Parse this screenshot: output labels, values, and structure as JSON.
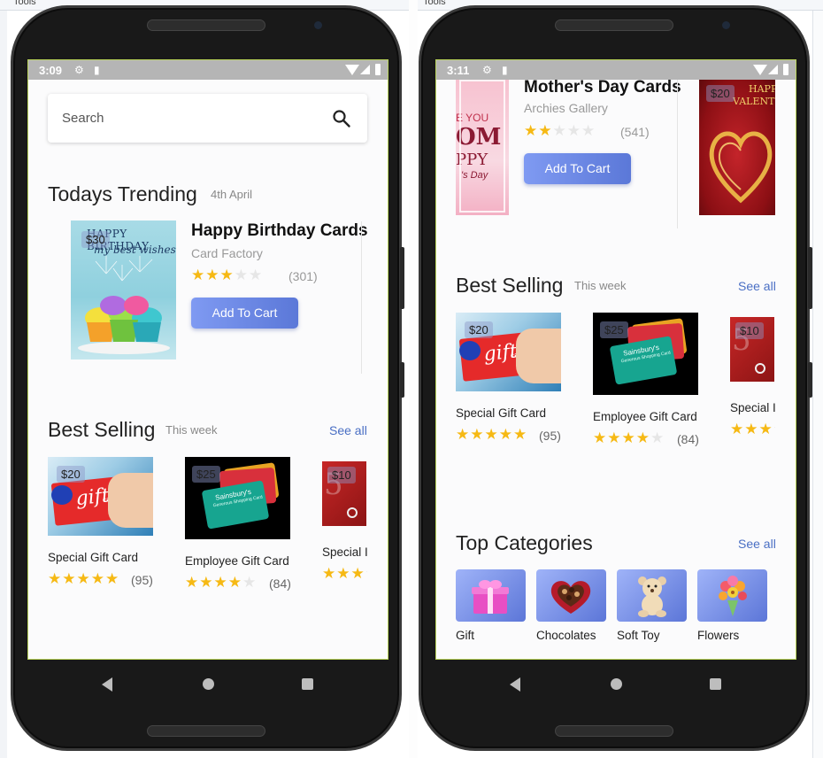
{
  "ide": {
    "menu_left": "Tools",
    "menu_right": "Tools"
  },
  "left": {
    "status": {
      "time": "3:09"
    },
    "search": {
      "placeholder": "Search"
    },
    "trending": {
      "title": "Todays Trending",
      "date": "4th April",
      "card": {
        "title": "Happy Birthday Cards",
        "vendor": "Card Factory",
        "rating": 3,
        "reviews": "(301)",
        "price": "$30",
        "button": "Add To Cart",
        "image_text": [
          "HAPPY BIRTHDAY",
          "my best wishes"
        ]
      }
    },
    "best_selling": {
      "title": "Best Selling",
      "subtitle": "This week",
      "see_all": "See all",
      "items": [
        {
          "name": "Special Gift Card",
          "price": "$20",
          "rating": 5,
          "reviews": "(95)"
        },
        {
          "name": "Employee Gift Card",
          "price": "$25",
          "rating": 4,
          "reviews": "(84)"
        },
        {
          "name": "Special I",
          "price": "$10",
          "rating": 3,
          "reviews": ""
        }
      ]
    }
  },
  "right": {
    "status": {
      "time": "3:11"
    },
    "trending_card": {
      "title": "Mother's Day Cards",
      "vendor": "Archies Gallery",
      "rating": 2,
      "reviews": "(541)",
      "button": "Add To Cart",
      "image_text": [
        "E YOU",
        "OM",
        "PPY",
        "'s Day"
      ]
    },
    "next_card": {
      "price": "$20",
      "image_text": [
        "HAPPY",
        "VALENTINE'S"
      ]
    },
    "best_selling": {
      "title": "Best Selling",
      "subtitle": "This week",
      "see_all": "See all",
      "items": [
        {
          "name": "Special Gift Card",
          "price": "$20",
          "rating": 5,
          "reviews": "(95)"
        },
        {
          "name": "Employee Gift Card",
          "price": "$25",
          "rating": 4,
          "reviews": "(84)"
        },
        {
          "name": "Special I",
          "price": "$10",
          "rating": 3,
          "reviews": ""
        }
      ]
    },
    "top_categories": {
      "title": "Top Categories",
      "see_all": "See all",
      "items": [
        {
          "label": "Gift",
          "icon": "gift-box-icon"
        },
        {
          "label": "Chocolates",
          "icon": "chocolate-box-icon"
        },
        {
          "label": "Soft Toy",
          "icon": "teddy-bear-icon"
        },
        {
          "label": "Flowers",
          "icon": "flower-bouquet-icon"
        }
      ]
    }
  },
  "gift_card_text": {
    "brand": "Sainsbury's",
    "sub": "Generous Shopping Card",
    "gift": "gift",
    "card": "card"
  },
  "colors": {
    "accent": "#5b78d8",
    "star": "#f6b914",
    "screen_bg": "#fbfbfc",
    "see_all": "#4a6fc4"
  }
}
